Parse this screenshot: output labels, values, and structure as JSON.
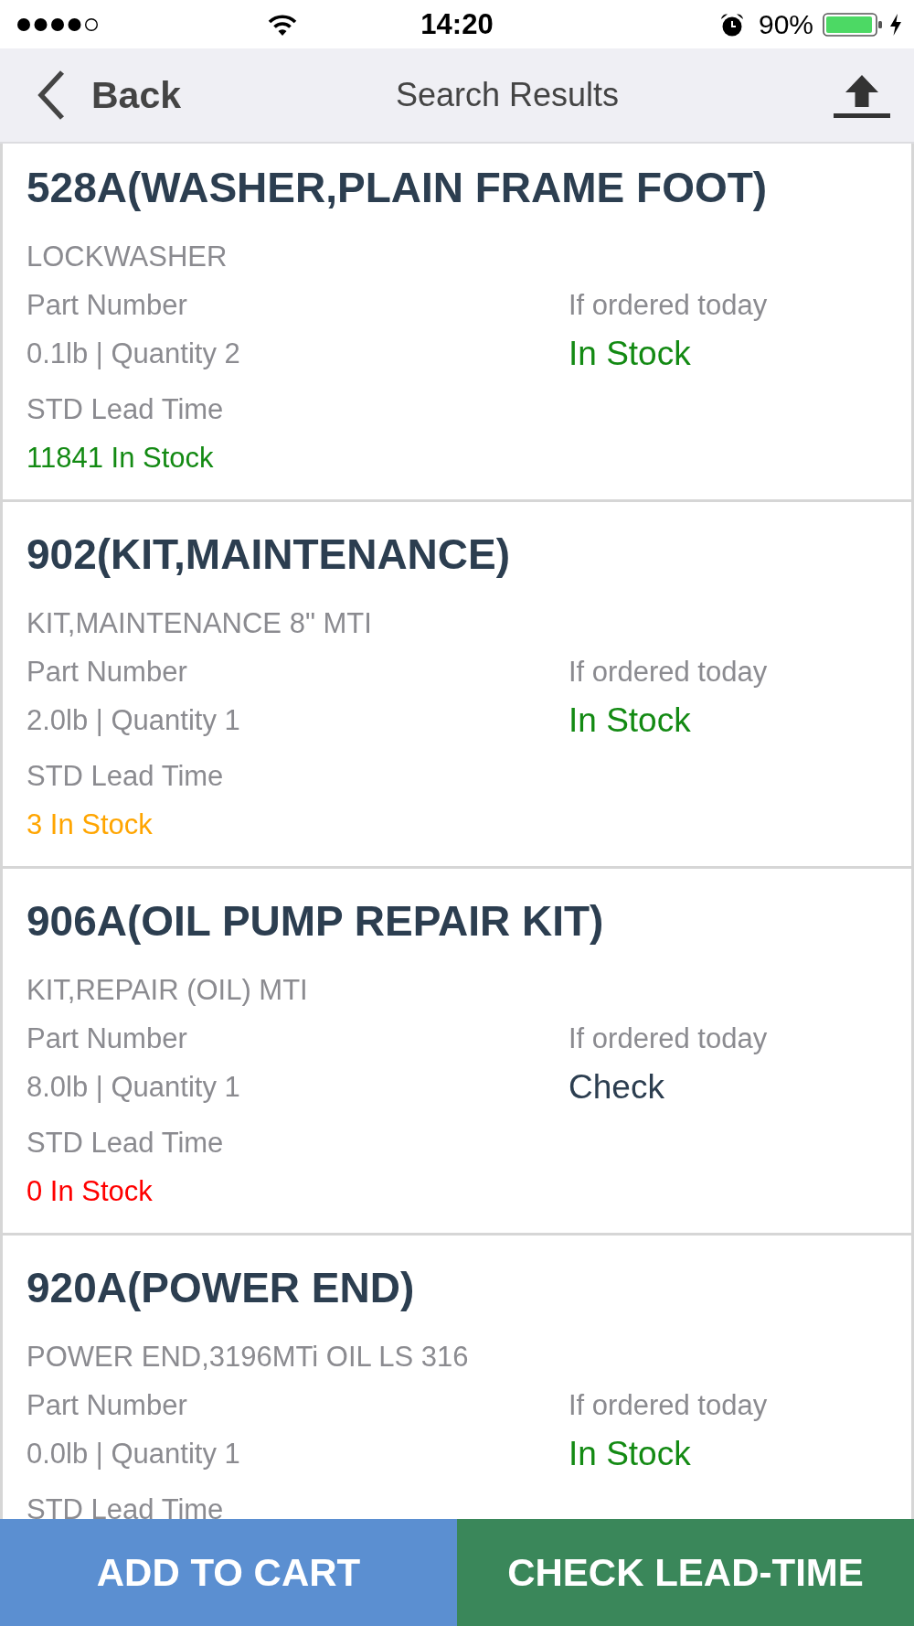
{
  "status_bar": {
    "time": "14:20",
    "battery": "90%"
  },
  "nav_bar": {
    "back": "Back",
    "title": "Search Results"
  },
  "results": [
    {
      "title": "528A(WASHER,PLAIN FRAME FOOT)",
      "description": "LOCKWASHER",
      "part_label": "Part Number",
      "weight_quantity": "0.1lb | Quantity 2",
      "availability_label": "If ordered today",
      "availability": {
        "text": "In Stock",
        "color": "#138a13"
      },
      "lead_label": "STD Lead Time",
      "stock": {
        "text": "11841 In Stock",
        "color": "#138a13"
      }
    },
    {
      "title": "902(KIT,MAINTENANCE)",
      "description": "KIT,MAINTENANCE 8\" MTI",
      "part_label": "Part Number",
      "weight_quantity": "2.0lb | Quantity 1",
      "availability_label": "If ordered today",
      "availability": {
        "text": "In Stock",
        "color": "#138a13"
      },
      "lead_label": "STD Lead Time",
      "stock": {
        "text": "3 In Stock",
        "color": "#ffa500"
      }
    },
    {
      "title": "906A(OIL PUMP REPAIR KIT)",
      "description": "KIT,REPAIR (OIL) MTI",
      "part_label": "Part Number",
      "weight_quantity": "8.0lb | Quantity 1",
      "availability_label": "If ordered today",
      "availability": {
        "text": "Check",
        "color": "#2c3e50"
      },
      "lead_label": "STD Lead Time",
      "stock": {
        "text": "0 In Stock",
        "color": "#ff0000"
      }
    },
    {
      "title": "920A(POWER END)",
      "description": "POWER END,3196MTi OIL LS 316",
      "part_label": "Part Number",
      "weight_quantity": "0.0lb | Quantity 1",
      "availability_label": "If ordered today",
      "availability": {
        "text": "In Stock",
        "color": "#138a13"
      },
      "lead_label": "STD Lead Time"
    }
  ],
  "actions": [
    {
      "label": "ADD TO CART",
      "color": "#5b8fd1"
    },
    {
      "label": "CHECK LEAD-TIME",
      "color": "#3a875a"
    }
  ]
}
